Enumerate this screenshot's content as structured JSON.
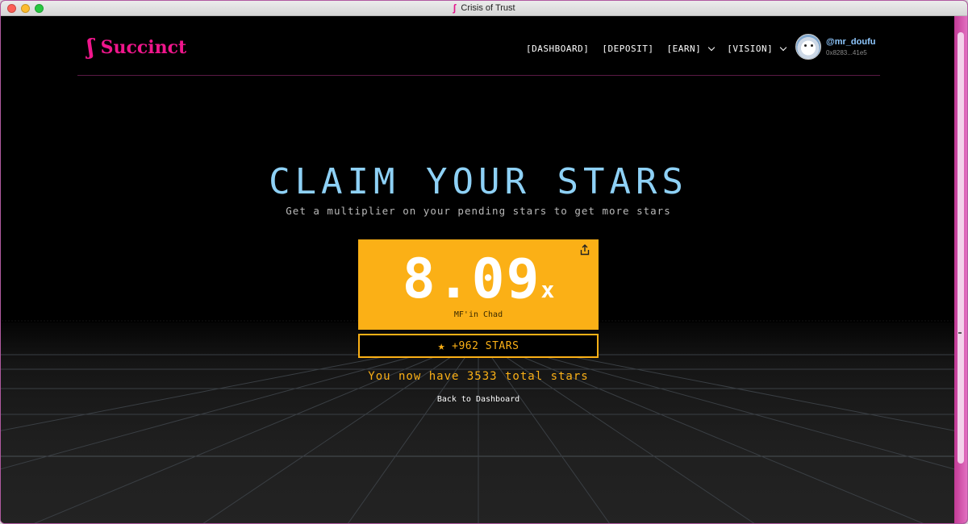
{
  "window": {
    "title": "Crisis of Trust"
  },
  "header": {
    "brand": "Succinct",
    "nav": [
      {
        "label": "[DASHBOARD]",
        "dropdown": false
      },
      {
        "label": "[DEPOSIT]",
        "dropdown": false
      },
      {
        "label": "[EARN]",
        "dropdown": true
      },
      {
        "label": "[VISION]",
        "dropdown": true
      }
    ],
    "user": {
      "name": "@mr_doufu",
      "address": "0x8283...41e5"
    }
  },
  "hero": {
    "title": "CLAIM YOUR STARS",
    "subtitle": "Get a multiplier on your pending stars to get more stars"
  },
  "card": {
    "multiplier": "8.09",
    "suffix": "x",
    "rank": "MF'in Chad"
  },
  "stars_bar": {
    "label": "+962 STARS"
  },
  "total_text": "You now have 3533 total stars",
  "back_link": "Back to Dashboard",
  "colors": {
    "accent": "#fbb016",
    "brand": "#f0168c",
    "title": "#8ed1f6"
  }
}
